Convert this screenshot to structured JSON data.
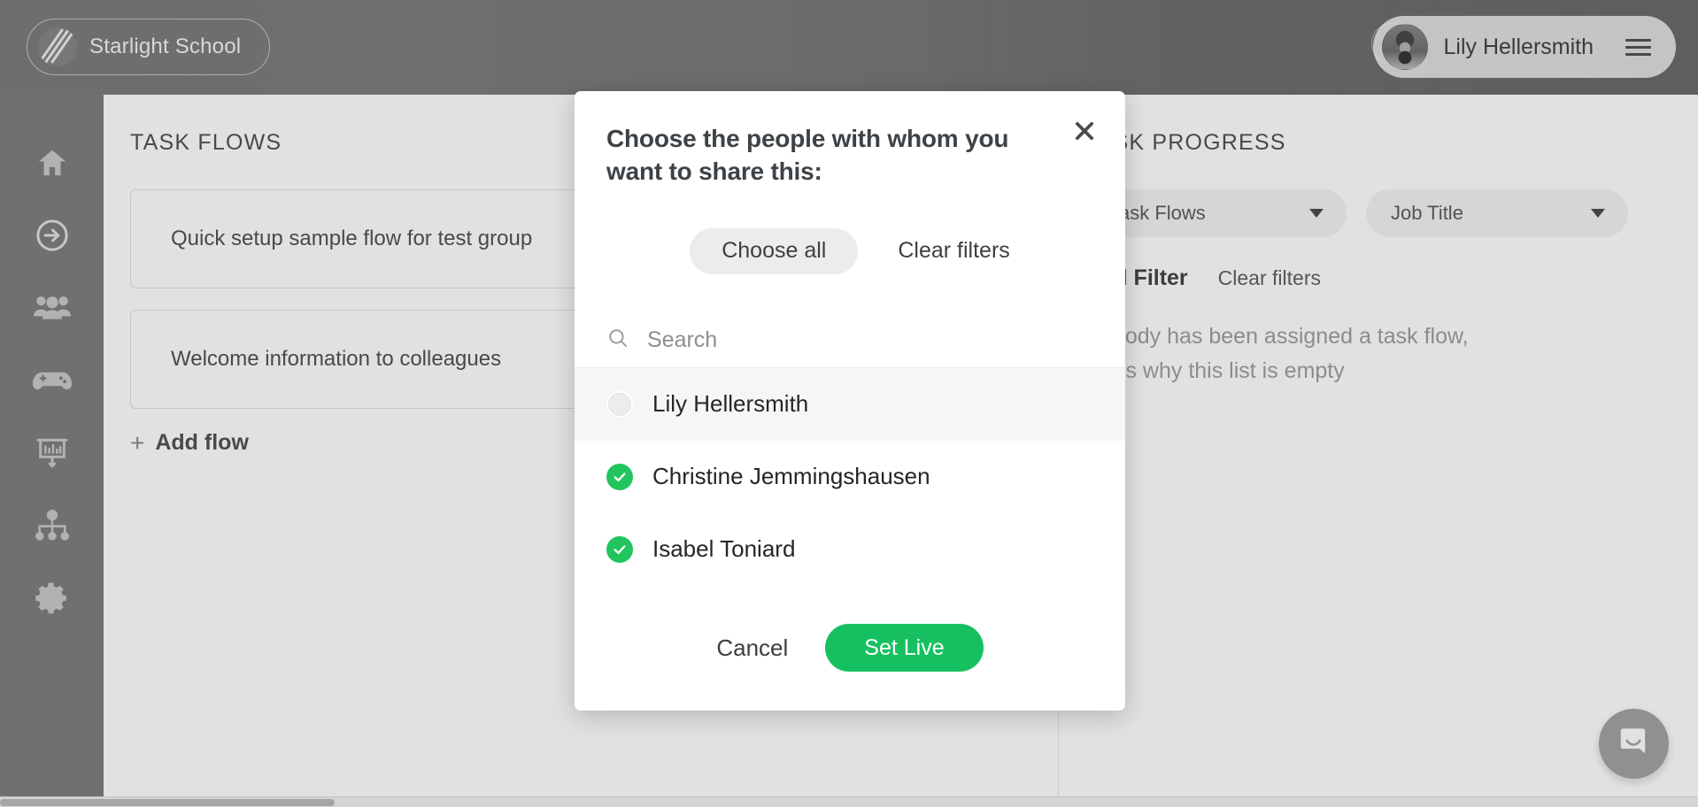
{
  "topbar": {
    "brand_name": "Starlight School",
    "brand_logo_icon": "slash-logo-icon",
    "more_icon": "ellipsis-icon",
    "user_name": "Lily Hellersmith",
    "avatar_icon": "user-avatar",
    "menu_icon": "hamburger-icon"
  },
  "sidebar": {
    "items": [
      {
        "name": "home",
        "icon": "home-icon",
        "active": false
      },
      {
        "name": "task-flows",
        "icon": "arrow-right-circle-icon",
        "active": true
      },
      {
        "name": "people",
        "icon": "people-group-icon",
        "active": false
      },
      {
        "name": "games",
        "icon": "game-controller-icon",
        "active": false
      },
      {
        "name": "presentations",
        "icon": "presentation-chart-icon",
        "active": false
      },
      {
        "name": "org-chart",
        "icon": "org-chart-icon",
        "active": false
      },
      {
        "name": "settings",
        "icon": "gear-icon",
        "active": false
      }
    ]
  },
  "task_flows": {
    "title": "TASK FLOWS",
    "cards": [
      {
        "label": "Quick setup sample flow for test group"
      },
      {
        "label": "Welcome information to colleagues"
      }
    ],
    "add_flow_label": "Add flow",
    "add_flow_icon": "plus-icon",
    "add_flow_color": "#22aa55"
  },
  "task_progress": {
    "title": "TASK PROGRESS",
    "filters": [
      {
        "label": "Task Flows",
        "icon": "chevron-down-icon"
      },
      {
        "label": "Job Title",
        "icon": "chevron-down-icon"
      }
    ],
    "add_filter_label": "Add Filter",
    "clear_filters_label": "Clear filters",
    "empty_line_1": "Nobody has been assigned a task flow,",
    "empty_line_2": "that's why this list is empty"
  },
  "intercom": {
    "icon": "chat-bubble-icon",
    "color": "#f2913d"
  },
  "modal": {
    "title": "Choose the people with whom you want to share this:",
    "close_icon": "close-icon",
    "choose_all_label": "Choose all",
    "clear_filters_label": "Clear filters",
    "search": {
      "placeholder": "Search",
      "value": "",
      "icon": "search-icon"
    },
    "people": [
      {
        "name": "Lily Hellersmith",
        "checked": false,
        "highlight": true
      },
      {
        "name": "Christine Jemmingshausen",
        "checked": true,
        "highlight": false
      },
      {
        "name": "Isabel Toniard",
        "checked": true,
        "highlight": false
      }
    ],
    "cancel_label": "Cancel",
    "submit_label": "Set Live",
    "submit_color": "#16c060"
  }
}
